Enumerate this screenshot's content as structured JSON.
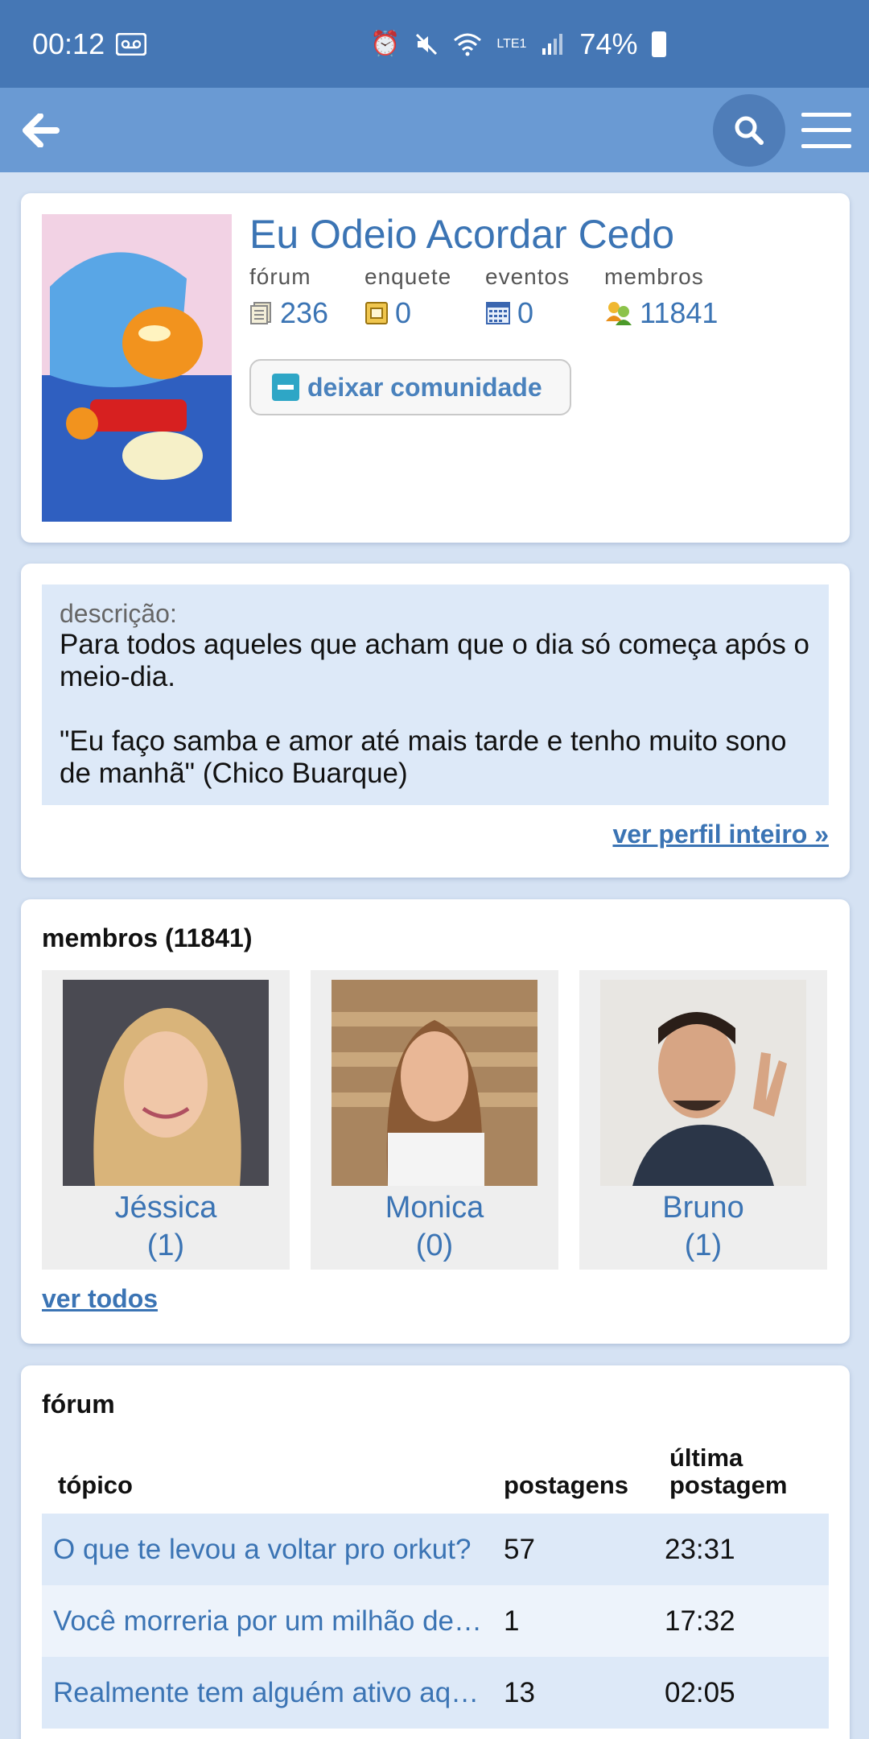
{
  "status_bar": {
    "time": "00:12",
    "battery": "74%",
    "network": "LTE1"
  },
  "community": {
    "title": "Eu Odeio Acordar Cedo",
    "stats": [
      {
        "label": "fórum",
        "value": "236",
        "icon": "forum-icon"
      },
      {
        "label": "enquete",
        "value": "0",
        "icon": "poll-icon"
      },
      {
        "label": "eventos",
        "value": "0",
        "icon": "calendar-icon"
      },
      {
        "label": "membros",
        "value": "11841",
        "icon": "members-icon"
      }
    ],
    "leave_label": "deixar comunidade"
  },
  "description": {
    "label": "descrição:",
    "text": "Para todos aqueles que acham que o dia só começa após o meio-dia.\n\n\"Eu faço samba e amor até mais tarde e tenho muito sono de manhã\" (Chico Buarque)",
    "profile_link": "ver perfil inteiro »"
  },
  "members": {
    "title": "membros (11841)",
    "list": [
      {
        "name": "Jéssica",
        "count": "(1)"
      },
      {
        "name": "Monica",
        "count": "(0)"
      },
      {
        "name": "Bruno",
        "count": "(1)"
      }
    ],
    "see_all": "ver todos"
  },
  "forum": {
    "title": "fórum",
    "headers": {
      "topic": "tópico",
      "posts": "postagens",
      "last": "última postagem"
    },
    "rows": [
      {
        "topic": "O que te levou a voltar pro orkut?",
        "posts": "57",
        "last": "23:31"
      },
      {
        "topic": "Você morreria por um milhão de reais?",
        "posts": "1",
        "last": "17:32"
      },
      {
        "topic": "Realmente tem alguém ativo aqui?",
        "posts": "13",
        "last": "02:05"
      }
    ]
  },
  "colors": {
    "status_bar": "#4577b5",
    "app_bar": "#6a9ad3",
    "link": "#3b74b4",
    "background": "#d5e2f3"
  }
}
